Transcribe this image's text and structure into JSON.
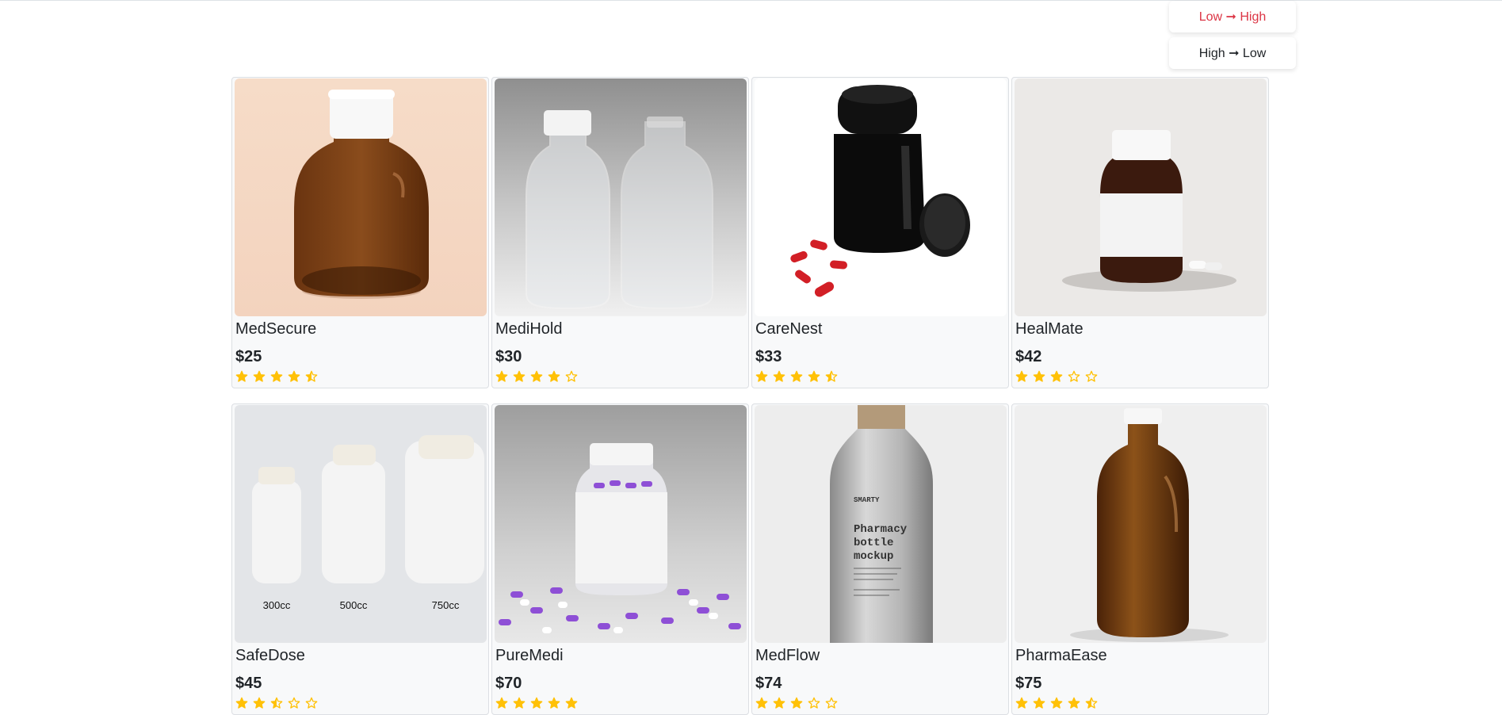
{
  "sort": {
    "options": [
      {
        "label": "Low ➞ High",
        "active": true
      },
      {
        "label": "High ➞ Low",
        "active": false
      }
    ]
  },
  "products": [
    {
      "name": "MedSecure",
      "price": "$25",
      "rating": 4.5,
      "image_icon": "amber-glass-bottle-icon"
    },
    {
      "name": "MediHold",
      "price": "$30",
      "rating": 4,
      "image_icon": "clear-plastic-bottles-icon"
    },
    {
      "name": "CareNest",
      "price": "$33",
      "rating": 4.5,
      "image_icon": "black-pill-bottle-icon"
    },
    {
      "name": "HealMate",
      "price": "$42",
      "rating": 3,
      "image_icon": "labeled-pill-bottle-icon"
    },
    {
      "name": "SafeDose",
      "price": "$45",
      "rating": 2.5,
      "image_icon": "white-bottles-set-icon",
      "image_captions": [
        "300cc",
        "500cc",
        "750cc"
      ]
    },
    {
      "name": "PureMedi",
      "price": "$70",
      "rating": 5,
      "image_icon": "capsule-bottle-icon"
    },
    {
      "name": "MedFlow",
      "price": "$74",
      "rating": 3,
      "image_icon": "aluminum-bottle-icon",
      "image_text": [
        "SMARTY",
        "Pharmacy",
        "bottle",
        "mockup"
      ]
    },
    {
      "name": "PharmaEase",
      "price": "$75",
      "rating": 4.5,
      "image_icon": "amber-round-bottle-icon"
    }
  ],
  "colors": {
    "accent": "#dc3545",
    "star": "#ffc107",
    "card_bg": "#f8f9fa"
  }
}
